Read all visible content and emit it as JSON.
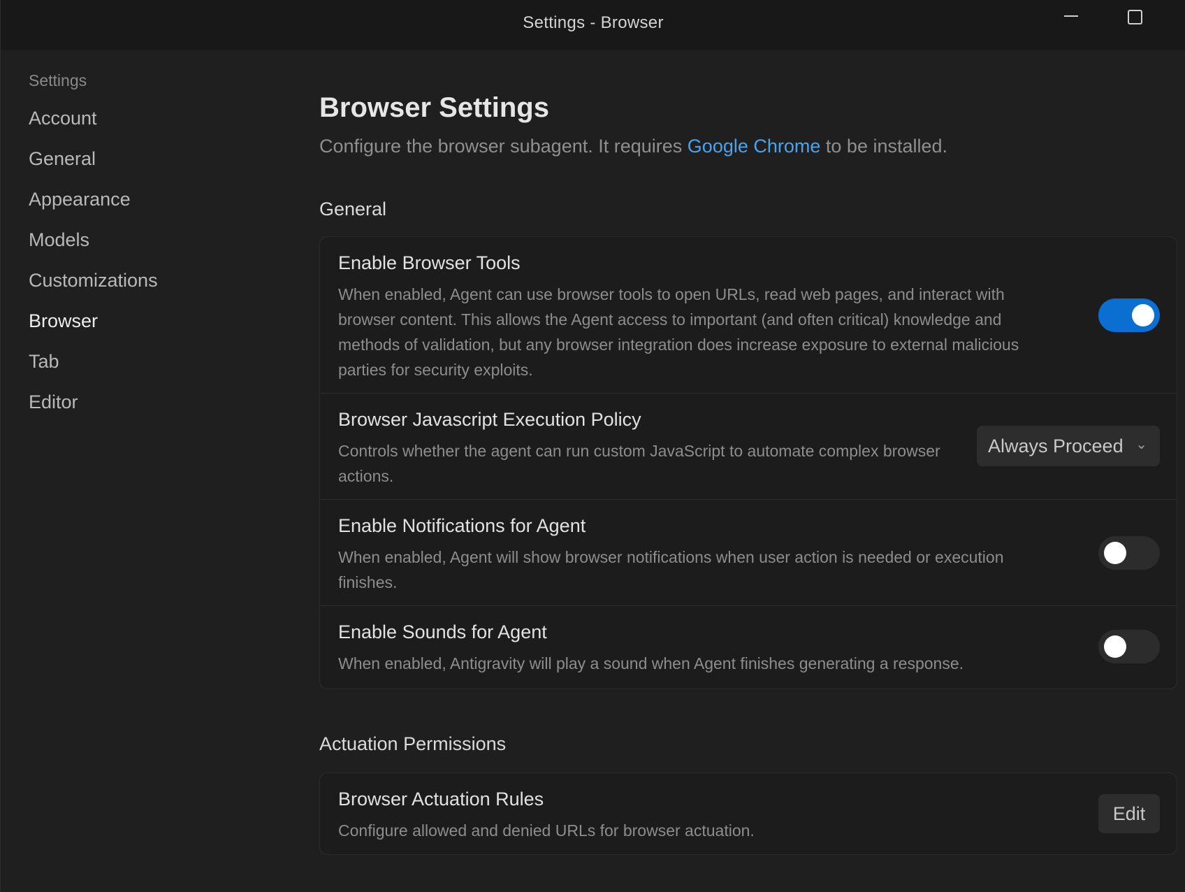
{
  "window": {
    "title": "Settings - Browser"
  },
  "sidebar": {
    "heading": "Settings",
    "items": [
      {
        "label": "Account"
      },
      {
        "label": "General"
      },
      {
        "label": "Appearance"
      },
      {
        "label": "Models"
      },
      {
        "label": "Customizations"
      },
      {
        "label": "Browser",
        "active": true
      },
      {
        "label": "Tab"
      },
      {
        "label": "Editor"
      }
    ]
  },
  "main": {
    "title": "Browser Settings",
    "subtitle_before": "Configure the browser subagent. It requires ",
    "subtitle_link": "Google Chrome",
    "subtitle_after": " to be installed.",
    "general": {
      "title": "General",
      "rows": [
        {
          "title": "Enable Browser Tools",
          "description": "When enabled, Agent can use browser tools to open URLs, read web pages, and interact with browser content. This allows the Agent access to important (and often critical) knowledge and methods of validation, but any browser integration does increase exposure to external malicious parties for security exploits.",
          "toggle": true
        },
        {
          "title": "Browser Javascript Execution Policy",
          "description": "Controls whether the agent can run custom JavaScript to automate complex browser actions.",
          "selected": "Always Proceed"
        },
        {
          "title": "Enable Notifications for Agent",
          "description": "When enabled, Agent will show browser notifications when user action is needed or execution finishes.",
          "toggle": false
        },
        {
          "title": "Enable Sounds for Agent",
          "description": "When enabled, Antigravity will play a sound when Agent finishes generating a response.",
          "toggle": false
        }
      ]
    },
    "actuation": {
      "title": "Actuation Permissions",
      "rows": [
        {
          "title": "Browser Actuation Rules",
          "description": "Configure allowed and denied URLs for browser actuation.",
          "button": "Edit"
        }
      ]
    }
  },
  "icons": {
    "dropdown_chevron": "⌄"
  },
  "colors": {
    "accent": "#0a6fd1",
    "link": "#4aa3f0",
    "background": "#1f1f1f",
    "titlebar": "#181818"
  }
}
